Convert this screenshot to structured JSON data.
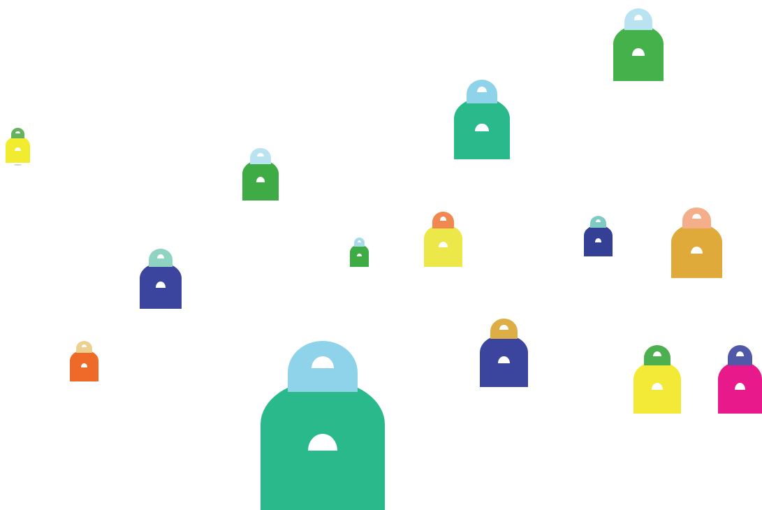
{
  "scene": {
    "background": "#ffffff",
    "icon_name": "lock-bag-icon",
    "items": [
      {
        "id": "bag-1",
        "handle_color": "#b9e3f0",
        "body_color": "#44b14a"
      },
      {
        "id": "bag-2",
        "handle_color": "#8fd3ea",
        "body_color": "#2ab98a"
      },
      {
        "id": "bag-3",
        "handle_color": "#63b45c",
        "body_color": "#f2ec31"
      },
      {
        "id": "bag-4",
        "handle_color": "#b9e3f0",
        "body_color": "#3fab45"
      },
      {
        "id": "bag-5",
        "handle_color": "#8fd3c2",
        "body_color": "#3b459d"
      },
      {
        "id": "bag-6",
        "handle_color": "#a9d9ea",
        "body_color": "#3fab45"
      },
      {
        "id": "bag-7",
        "handle_color": "#f0884f",
        "body_color": "#ece84a"
      },
      {
        "id": "bag-8",
        "handle_color": "#7fcbc3",
        "body_color": "#343f96"
      },
      {
        "id": "bag-9",
        "handle_color": "#f4ae8a",
        "body_color": "#dfaa3a"
      },
      {
        "id": "bag-10",
        "handle_color": "#ecd08e",
        "body_color": "#ef6a28"
      },
      {
        "id": "bag-11",
        "handle_color": "#8fd3ea",
        "body_color": "#2ab98a"
      },
      {
        "id": "bag-12",
        "handle_color": "#dcae45",
        "body_color": "#3b459d"
      },
      {
        "id": "bag-13",
        "handle_color": "#4caf50",
        "body_color": "#f2ea37"
      },
      {
        "id": "bag-14",
        "handle_color": "#5058a8",
        "body_color": "#e8198b"
      }
    ]
  }
}
